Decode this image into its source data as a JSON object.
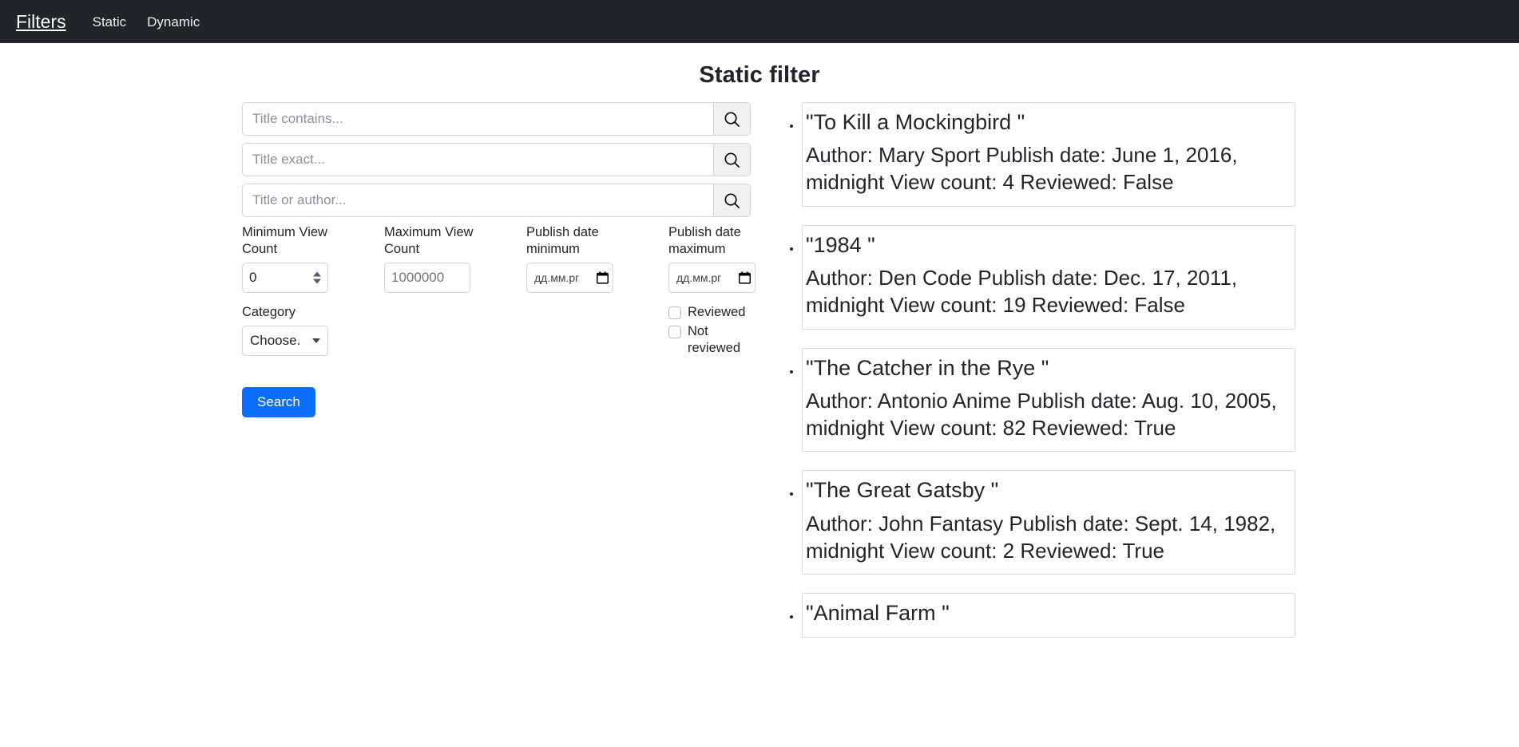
{
  "navbar": {
    "brand": "Filters",
    "links": [
      {
        "label": "Static"
      },
      {
        "label": "Dynamic"
      }
    ]
  },
  "page": {
    "title": "Static filter"
  },
  "filters": {
    "text_inputs": [
      {
        "name": "title-contains",
        "value": "",
        "placeholder": "Title contains...",
        "icon": "search-icon"
      },
      {
        "name": "title-exact",
        "value": "",
        "placeholder": "Title exact...",
        "icon": "search-icon"
      },
      {
        "name": "title-or-author",
        "value": "",
        "placeholder": "Title or author...",
        "icon": "search-icon"
      }
    ],
    "min_view_count": {
      "label": "Minimum View Count",
      "value": "0",
      "placeholder": ""
    },
    "max_view_count": {
      "label": "Maximum View Count",
      "value": "",
      "placeholder": "1000000"
    },
    "publish_date_min": {
      "label": "Publish date minimum",
      "value": "",
      "placeholder": "дд.мм.рг"
    },
    "publish_date_max": {
      "label": "Publish date maximum",
      "value": "",
      "placeholder": "дд.мм.рг"
    },
    "checkboxes": [
      {
        "label": "Reviewed",
        "checked": false
      },
      {
        "label": "Not reviewed",
        "checked": false
      }
    ],
    "category": {
      "label": "Category",
      "selected": "Choose.",
      "options": [
        "Choose."
      ]
    },
    "submit_label": "Search"
  },
  "results": [
    {
      "title": "\"To Kill a Mockingbird \"",
      "meta": "Author: Mary Sport Publish date: June 1, 2016, midnight View count: 4 Reviewed: False"
    },
    {
      "title": "\"1984 \"",
      "meta": "Author: Den Code Publish date: Dec. 17, 2011, midnight View count: 19 Reviewed: False"
    },
    {
      "title": "\"The Catcher in the Rye \"",
      "meta": "Author: Antonio Anime Publish date: Aug. 10, 2005, midnight View count: 82 Reviewed: True"
    },
    {
      "title": "\"The Great Gatsby \"",
      "meta": "Author: John Fantasy Publish date: Sept. 14, 1982, midnight View count: 2 Reviewed: True"
    },
    {
      "title": "\"Animal Farm \"",
      "meta": ""
    }
  ],
  "colors": {
    "navbar_bg": "#212529",
    "primary": "#0d6efd",
    "border": "#ced4da",
    "card_border": "#dcdcdc",
    "placeholder": "#8b9199"
  }
}
